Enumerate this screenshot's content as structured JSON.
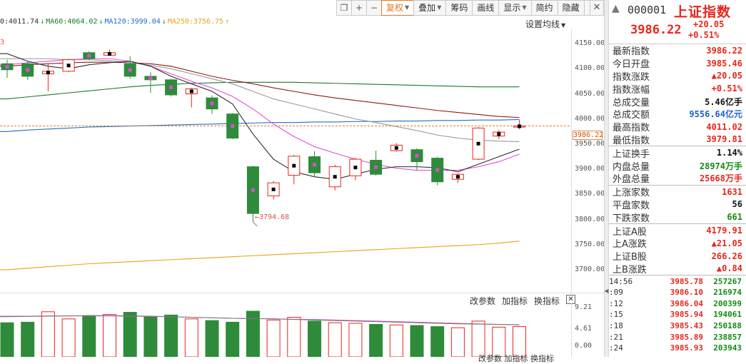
{
  "toolbar": {
    "buttons": [
      {
        "label": "❐",
        "name": "restore-window-button",
        "icon": true
      },
      {
        "label": "+",
        "name": "zoom-in-button",
        "icon": true
      },
      {
        "label": "−",
        "name": "zoom-out-button",
        "icon": true
      },
      {
        "label": "复权",
        "name": "adjust-button",
        "caret": true,
        "active": true
      },
      {
        "label": "叠加",
        "name": "overlay-button",
        "caret": true
      },
      {
        "label": "筹码",
        "name": "chips-button"
      },
      {
        "label": "画线",
        "name": "draw-line-button"
      },
      {
        "label": "显示",
        "name": "display-button",
        "caret": true
      },
      {
        "label": "简约",
        "name": "simple-button"
      },
      {
        "label": "隐藏",
        "name": "hide-button"
      }
    ],
    "more_label": "»",
    "close_label": "✕"
  },
  "ma_legend": [
    {
      "text": "0:4011.74",
      "color": "#333333"
    },
    {
      "text": "↓",
      "color": "#1a9a3a"
    },
    {
      "text": "MA60:4064.02",
      "color": "#1a7a2a"
    },
    {
      "text": "↓",
      "color": "#1a9a3a"
    },
    {
      "text": "MA120:3999.04",
      "color": "#1c6fd0"
    },
    {
      "text": "↓",
      "color": "#1a9a3a"
    },
    {
      "text": "MA250:3756.75",
      "color": "#e8a317"
    },
    {
      "text": "↑",
      "color": "#e8a317"
    }
  ],
  "settings_avg_label": "设置均线",
  "stray_marker": "3",
  "price_axis_labels": [
    "4150.00",
    "4100.00",
    "4050.00",
    "4000.00",
    "3950.00",
    "3900.00",
    "3850.00",
    "3800.00",
    "3750.00",
    "3700.00"
  ],
  "current_price_label": "3986.22",
  "low_annotation": "←3794.68",
  "volume_toolbar": {
    "change_params": "改参数",
    "add_indicator": "加指标",
    "switch_indicator": "换指标",
    "close": "✕"
  },
  "volume_axis_labels": [
    "9.21",
    "4.61",
    "0.00"
  ],
  "bottom_cut_text": "改参数  加指标  换指标",
  "colors": {
    "up": "#e8261b",
    "down": "#2e8b3a",
    "ma5": "#2b2b2b",
    "ma10": "#e84bd8",
    "ma20": "#999999",
    "ma30": "#8b1a1a",
    "ma60": "#1a7a2a",
    "ma120": "#1c6fd0",
    "ma250": "#e8a317"
  },
  "chart_data": {
    "type": "candlestick",
    "ylim": [
      3690,
      4180
    ],
    "candles": [
      {
        "o": 4110,
        "c": 4098,
        "h": 4118,
        "l": 4082
      },
      {
        "o": 4110,
        "c": 4085,
        "h": 4115,
        "l": 4078
      },
      {
        "o": 4090,
        "c": 4095,
        "h": 4110,
        "l": 4055
      },
      {
        "o": 4095,
        "c": 4118,
        "h": 4120,
        "l": 4093
      },
      {
        "o": 4132,
        "c": 4120,
        "h": 4135,
        "l": 4117
      },
      {
        "o": 4127,
        "c": 4132,
        "h": 4138,
        "l": 4126
      },
      {
        "o": 4110,
        "c": 4085,
        "h": 4125,
        "l": 4080
      },
      {
        "o": 4085,
        "c": 4078,
        "h": 4093,
        "l": 4052
      },
      {
        "o": 4078,
        "c": 4048,
        "h": 4080,
        "l": 4045
      },
      {
        "o": 4050,
        "c": 4060,
        "h": 4062,
        "l": 4023
      },
      {
        "o": 4042,
        "c": 4020,
        "h": 4047,
        "l": 4010
      },
      {
        "o": 4010,
        "c": 3962,
        "h": 4012,
        "l": 3960
      },
      {
        "o": 3905,
        "c": 3812,
        "h": 3907,
        "l": 3795
      },
      {
        "o": 3847,
        "c": 3873,
        "h": 3877,
        "l": 3840
      },
      {
        "o": 3888,
        "c": 3926,
        "h": 3929,
        "l": 3870
      },
      {
        "o": 3925,
        "c": 3893,
        "h": 3936,
        "l": 3885
      },
      {
        "o": 3865,
        "c": 3905,
        "h": 3909,
        "l": 3858
      },
      {
        "o": 3887,
        "c": 3920,
        "h": 3923,
        "l": 3878
      },
      {
        "o": 3918,
        "c": 3890,
        "h": 3937,
        "l": 3887
      },
      {
        "o": 3937,
        "c": 3948,
        "h": 3952,
        "l": 3935
      },
      {
        "o": 3939,
        "c": 3915,
        "h": 3942,
        "l": 3898
      },
      {
        "o": 3922,
        "c": 3875,
        "h": 3925,
        "l": 3868
      },
      {
        "o": 3880,
        "c": 3890,
        "h": 3892,
        "l": 3873
      },
      {
        "o": 3920,
        "c": 3982,
        "h": 3984,
        "l": 3918
      },
      {
        "o": 3966,
        "c": 3974,
        "h": 3978,
        "l": 3960
      },
      {
        "o": 3985,
        "c": 3986,
        "h": 3998,
        "l": 3980
      }
    ],
    "ma_lines": {
      "ma5": [
        4130,
        4115,
        4105,
        4100,
        4108,
        4112,
        4115,
        4105,
        4085,
        4070,
        4055,
        4030,
        3970,
        3920,
        3895,
        3885,
        3880,
        3890,
        3900,
        3905,
        3905,
        3903,
        3895,
        3910,
        3925,
        3940
      ],
      "ma10": [
        4108,
        4112,
        4115,
        4118,
        4120,
        4120,
        4115,
        4105,
        4090,
        4075,
        4062,
        4045,
        4020,
        3990,
        3965,
        3945,
        3932,
        3920,
        3910,
        3902,
        3898,
        3898,
        3898,
        3905,
        3915,
        3930
      ],
      "ma20": [
        4120,
        4120,
        4120,
        4118,
        4118,
        4116,
        4112,
        4107,
        4100,
        4090,
        4080,
        4070,
        4055,
        4040,
        4030,
        4020,
        4010,
        4000,
        3993,
        3985,
        3977,
        3968,
        3962,
        3958,
        3956,
        3955
      ],
      "ma30": [
        4105,
        4108,
        4110,
        4112,
        4113,
        4113,
        4112,
        4110,
        4105,
        4095,
        4085,
        4077,
        4070,
        4062,
        4055,
        4048,
        4042,
        4037,
        4032,
        4027,
        4022,
        4017,
        4013,
        4009,
        4005,
        4003
      ],
      "ma60": [
        4040,
        4044,
        4048,
        4052,
        4056,
        4060,
        4064,
        4067,
        4069,
        4071,
        4072,
        4073,
        4073,
        4073,
        4073,
        4072,
        4071,
        4070,
        4069,
        4068,
        4067,
        4066,
        4065,
        4064,
        4064,
        4064
      ],
      "ma120": [
        3975,
        3978,
        3980,
        3982,
        3984,
        3985,
        3986,
        3987,
        3988,
        3989,
        3990,
        3991,
        3992,
        3993,
        3993,
        3994,
        3994,
        3995,
        3995,
        3996,
        3996,
        3997,
        3997,
        3998,
        3998,
        3999
      ],
      "ma250": [
        3700,
        3703,
        3706,
        3709,
        3712,
        3714,
        3716,
        3718,
        3720,
        3722,
        3724,
        3726,
        3728,
        3730,
        3732,
        3734,
        3736,
        3738,
        3740,
        3742,
        3744,
        3746,
        3748,
        3750,
        3753,
        3757
      ]
    },
    "current_price": 3986.22,
    "volume": {
      "ylim": [
        0,
        9.21
      ],
      "values": [
        6.2,
        6.3,
        8.2,
        6.9,
        7.5,
        7.7,
        8.1,
        7.3,
        7.6,
        6.9,
        6.6,
        6.3,
        8.3,
        6.7,
        7.2,
        6.5,
        6.2,
        6.1,
        5.9,
        5.8,
        5.7,
        5.5,
        5.3,
        6.5,
        5.4,
        5.5
      ],
      "ma_a": [
        7.4,
        7.4,
        7.45,
        7.45,
        7.45,
        7.45,
        7.4,
        7.35,
        7.3,
        7.2,
        7.1,
        7.0,
        6.95,
        6.9,
        6.85,
        6.8,
        6.7,
        6.6,
        6.5,
        6.4,
        6.3,
        6.2,
        6.1,
        6.0,
        5.9,
        5.8
      ],
      "ma_b": [
        7.3,
        7.35,
        7.4,
        7.45,
        7.5,
        7.5,
        7.45,
        7.4,
        7.3,
        7.2,
        7.1,
        7.0,
        6.95,
        6.9,
        6.8,
        6.7,
        6.6,
        6.5,
        6.4,
        6.3,
        6.2,
        6.1,
        6.0,
        5.95,
        5.9,
        5.85
      ]
    }
  },
  "panel": {
    "back_arrow": "▲",
    "code": "000001",
    "name": "上证指数",
    "price": "3986.22",
    "change": "+20.05",
    "change_pct": "+0.51%",
    "section1": [
      {
        "label": "最新指数",
        "value": "3986.22",
        "color": "red"
      },
      {
        "label": "今日开盘",
        "value": "3985.46",
        "color": "red"
      },
      {
        "label": "指数涨跌",
        "value": "▲20.05",
        "color": "red"
      },
      {
        "label": "指数涨幅",
        "value": "+0.51%",
        "color": "red"
      },
      {
        "label": "总成交量",
        "value": "5.46亿手",
        "color": "black"
      },
      {
        "label": "总成交额",
        "value": "9556.64亿元",
        "color": "blue"
      },
      {
        "label": "最高指数",
        "value": "4011.02",
        "color": "red"
      },
      {
        "label": "最低指数",
        "value": "3979.81",
        "color": "red"
      }
    ],
    "section2": [
      {
        "label": "上证换手",
        "value": "1.14%",
        "color": "black"
      },
      {
        "label": "内盘总量",
        "value": "28974万手",
        "color": "green"
      },
      {
        "label": "外盘总量",
        "value": "25668万手",
        "color": "red"
      }
    ],
    "section3": [
      {
        "label": "上涨家数",
        "value": "1631",
        "color": "red"
      },
      {
        "label": "平盘家数",
        "value": "56",
        "color": "black"
      },
      {
        "label": "下跌家数",
        "value": "661",
        "color": "green"
      }
    ],
    "section4": [
      {
        "label": "上证A股",
        "value": "4179.91",
        "color": "red"
      },
      {
        "label": "上A涨跌",
        "value": "▲21.05",
        "color": "red"
      },
      {
        "label": "上证B股",
        "value": "266.26",
        "color": "red"
      },
      {
        "label": "上B涨跌",
        "value": "▲0.84",
        "color": "red"
      }
    ],
    "ticks": [
      {
        "time": "14:56",
        "price": "3985.78",
        "vol": "257267"
      },
      {
        "time": ":09",
        "price": "3986.10",
        "vol": "216974"
      },
      {
        "time": ":12",
        "price": "3986.04",
        "vol": "200399"
      },
      {
        "time": ":15",
        "price": "3985.94",
        "vol": "194061"
      },
      {
        "time": ":18",
        "price": "3985.43",
        "vol": "250188"
      },
      {
        "time": ":21",
        "price": "3985.89",
        "vol": "238857"
      },
      {
        "time": ":24",
        "price": "3985.93",
        "vol": "203943"
      }
    ]
  }
}
